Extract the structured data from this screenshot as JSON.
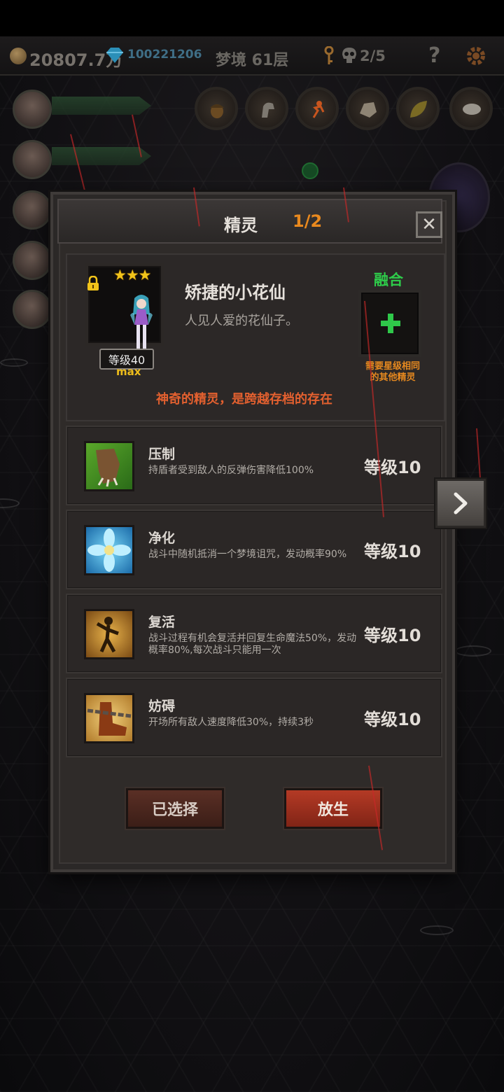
{
  "topbar": {
    "gold": "20807.7万",
    "diamonds": "100221206",
    "floor": "梦境 61层",
    "skull_count": "2/5",
    "help": "?"
  },
  "modal": {
    "title": "精灵",
    "page": "1/2",
    "close": "✕"
  },
  "spirit": {
    "name": "矫捷的小花仙",
    "description": "人见人爱的花仙子。",
    "stars": "★★★",
    "level_label": "等级40",
    "max_label": "max",
    "tagline": "神奇的精灵，是跨越存档的存在"
  },
  "fusion": {
    "label": "融合",
    "hint_line1": "需要星级相同",
    "hint_line2": "的其他精灵"
  },
  "skills": [
    {
      "name": "压制",
      "description": "持盾者受到敌人的反弹伤害降低100%",
      "level": "等级10",
      "icon": "claw-grass-icon"
    },
    {
      "name": "净化",
      "description": "战斗中随机抵消一个梦境诅咒，发动概率90%",
      "level": "等级10",
      "icon": "blue-flower-icon"
    },
    {
      "name": "复活",
      "description": "战斗过程有机会复活并回复生命魔法50%，发动概率80%,每次战斗只能用一次",
      "level": "等级10",
      "icon": "revive-figure-icon"
    },
    {
      "name": "妨碍",
      "description": "开场所有敌人速度降低30%，持续3秒",
      "level": "等级10",
      "icon": "chained-boot-icon"
    }
  ],
  "buttons": {
    "selected": "已选择",
    "release": "放生"
  },
  "colors": {
    "accent_orange": "#e9891e",
    "fuse_green": "#2ecc4a",
    "tagline_red": "#e3602f",
    "release_red": "#b43a25"
  }
}
